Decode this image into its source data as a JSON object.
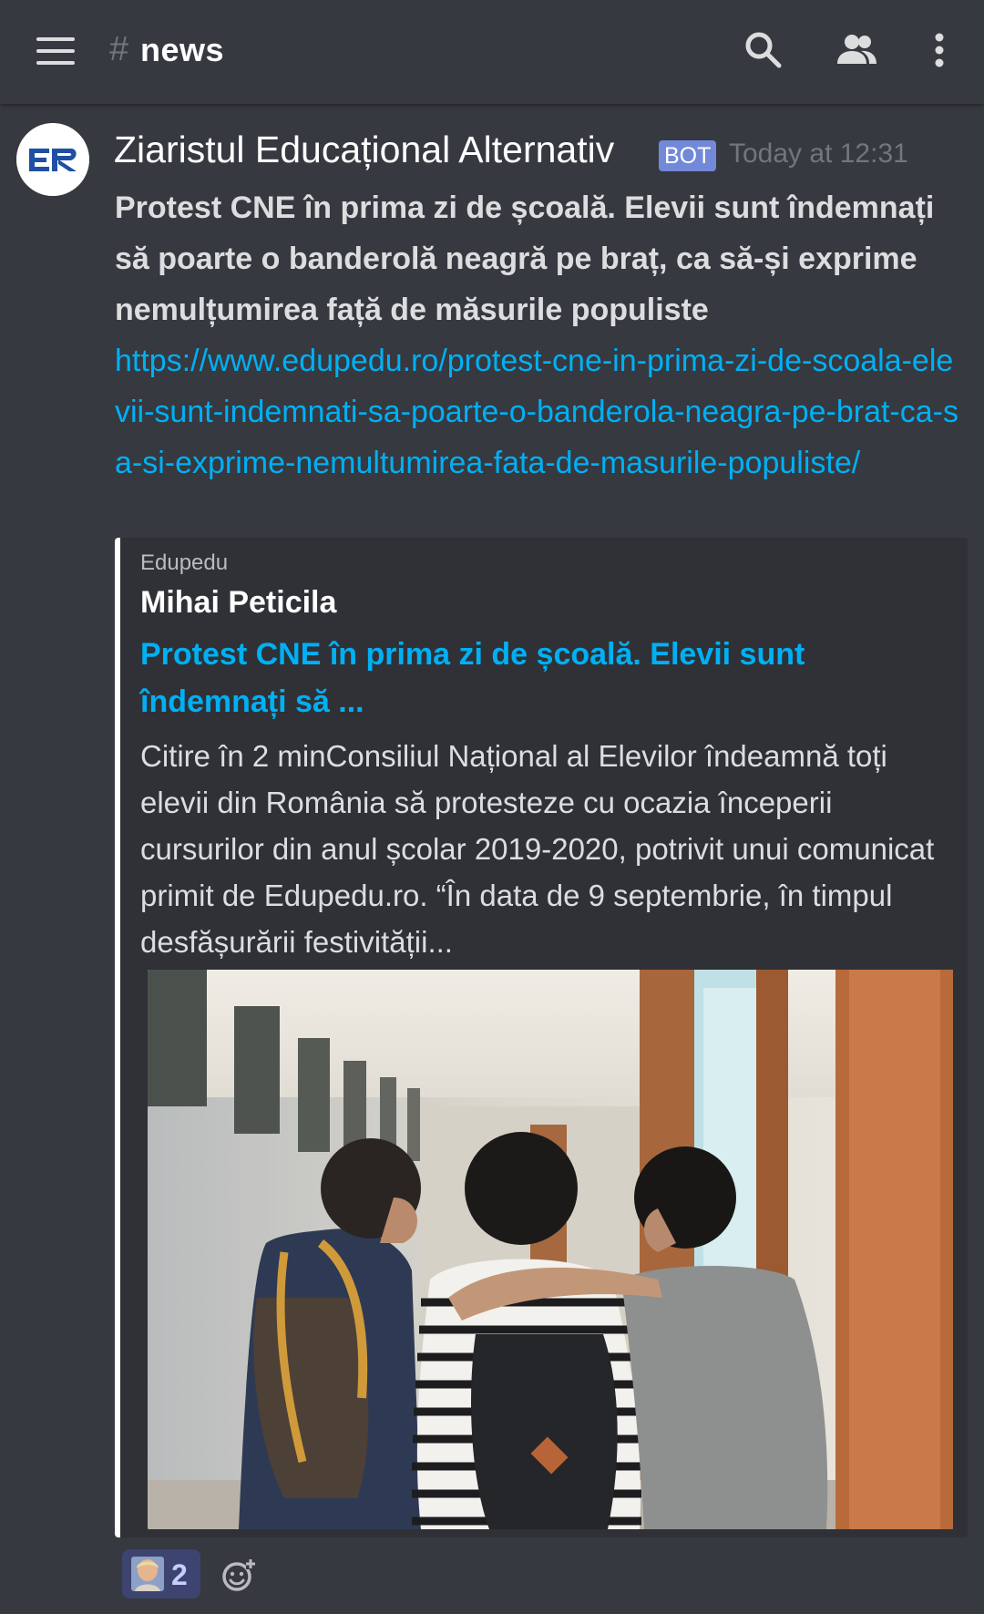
{
  "header": {
    "channel_prefix": "#",
    "channel_name": "news",
    "icons": [
      "hamburger-menu-icon",
      "search-icon",
      "members-icon",
      "more-options-icon"
    ]
  },
  "message": {
    "author": "Ziaristul Educațional Alternativ",
    "bot_tag": "BOT",
    "timestamp": "Today at 12:31",
    "text": "Protest CNE în prima zi de școală. Elevii sunt îndemnați să poarte o banderolă neagră pe braț, ca să-și exprime nemulțumirea față de măsurile populiste",
    "link": "https://www.edupedu.ro/protest-cne-in-prima-zi-de-scoala-elevii-sunt-indemnati-sa-poarte-o-banderola-neagra-pe-brat-ca-sa-si-exprime-nemultumirea-fata-de-masurile-populiste/"
  },
  "embed": {
    "provider": "Edupedu",
    "author": "Mihai Peticila",
    "title": "Protest CNE în prima zi de școală. Elevii sunt îndemnați să ...",
    "description": "Citire în 2 minConsiliul Național al Elevilor îndeamnă toți elevii din România să protesteze cu ocazia începerii cursurilor din anul școlar 2019-2020, potrivit unui comunicat primit de Edupedu.ro. “În data de 9 septembrie, în timpul desfășurării festivității..."
  },
  "reactions": [
    {
      "emoji": "person-emoji",
      "count": "2"
    }
  ],
  "colors": {
    "background": "#36393f",
    "embed_background": "#2f3136",
    "link": "#00b0f4",
    "bot_tag": "#7289da",
    "reaction_background": "#3d4470"
  }
}
